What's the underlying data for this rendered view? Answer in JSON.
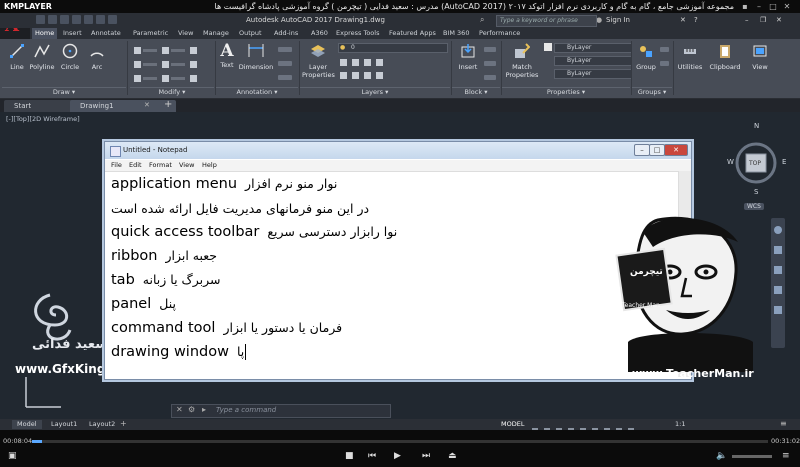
{
  "player": {
    "logo": "KMPLAYER",
    "title": "مجموعه آموزشی جامع ، گام به گام و کاربردی نرم افزار اتوکد ٢٠١٧ (AutoCAD 2017) مدرس : سعید فدایی ( تیچرمن ) گروه آموزشی پادشاه گرافیست ها",
    "time_current": "00:08:04",
    "time_total": "00:31:02"
  },
  "acad": {
    "title": "Autodesk AutoCAD 2017    Drawing1.dwg",
    "search_placeholder": "Type a keyword or phrase",
    "sign_in": "Sign In",
    "tabs": [
      "Home",
      "Insert",
      "Annotate",
      "Parametric",
      "View",
      "Manage",
      "Output",
      "Add-ins",
      "A360",
      "Express Tools",
      "Featured Apps",
      "BIM 360",
      "Performance"
    ],
    "draw_tools": [
      "Line",
      "Polyline",
      "Circle",
      "Arc"
    ],
    "groups": [
      "Draw",
      "Modify",
      "Annotation",
      "Layers",
      "Block",
      "Properties",
      "Groups"
    ],
    "annotation_tools": [
      "Text",
      "Dimension"
    ],
    "layer_tool": "Layer Properties",
    "block_tool": "Insert",
    "match_tool": "Match Properties",
    "group_tool": "Group",
    "utilities": "Utilities",
    "clipboard": "Clipboard",
    "view": "View",
    "bylayer": "ByLayer",
    "layer_value": "0",
    "doc_tabs": [
      "Start",
      "Drawing1"
    ],
    "view_label": "[-][Top][2D Wireframe]",
    "viewcube": {
      "top": "TOP",
      "n": "N",
      "s": "S",
      "e": "E",
      "w": "W",
      "wcs": "WCS"
    },
    "command_placeholder": "Type a command",
    "layout_tabs": [
      "Model",
      "Layout1",
      "Layout2"
    ],
    "status_model": "MODEL",
    "status_scale": "1:1"
  },
  "notepad": {
    "title": "Untitled - Notepad",
    "menu": [
      "File",
      "Edit",
      "Format",
      "View",
      "Help"
    ],
    "lines": [
      {
        "en": "application menu",
        "fa": "نوار منو نرم افزار"
      },
      {
        "en": "",
        "fa": "در این منو فرمانهای مدیریت فایل ارائه شده است"
      },
      {
        "en": "quick access toolbar",
        "fa": "نوا رابزار دسترسی سریع"
      },
      {
        "en": "ribbon",
        "fa": "جعبه ابزار"
      },
      {
        "en": "tab",
        "fa": "سربرگ یا زبانه"
      },
      {
        "en": "panel",
        "fa": "پنل"
      },
      {
        "en": "command tool",
        "fa": "فرمان یا دستور یا ابزار"
      },
      {
        "en": "drawing window",
        "fa": "پا"
      }
    ]
  },
  "watermark": {
    "left_name": "سعید فدائی",
    "left_site": "www.GfxKing.ir",
    "right_site": "www.TeacherMan.ir",
    "badge": "تیچرمن",
    "badge_en": "Teacher Man"
  }
}
